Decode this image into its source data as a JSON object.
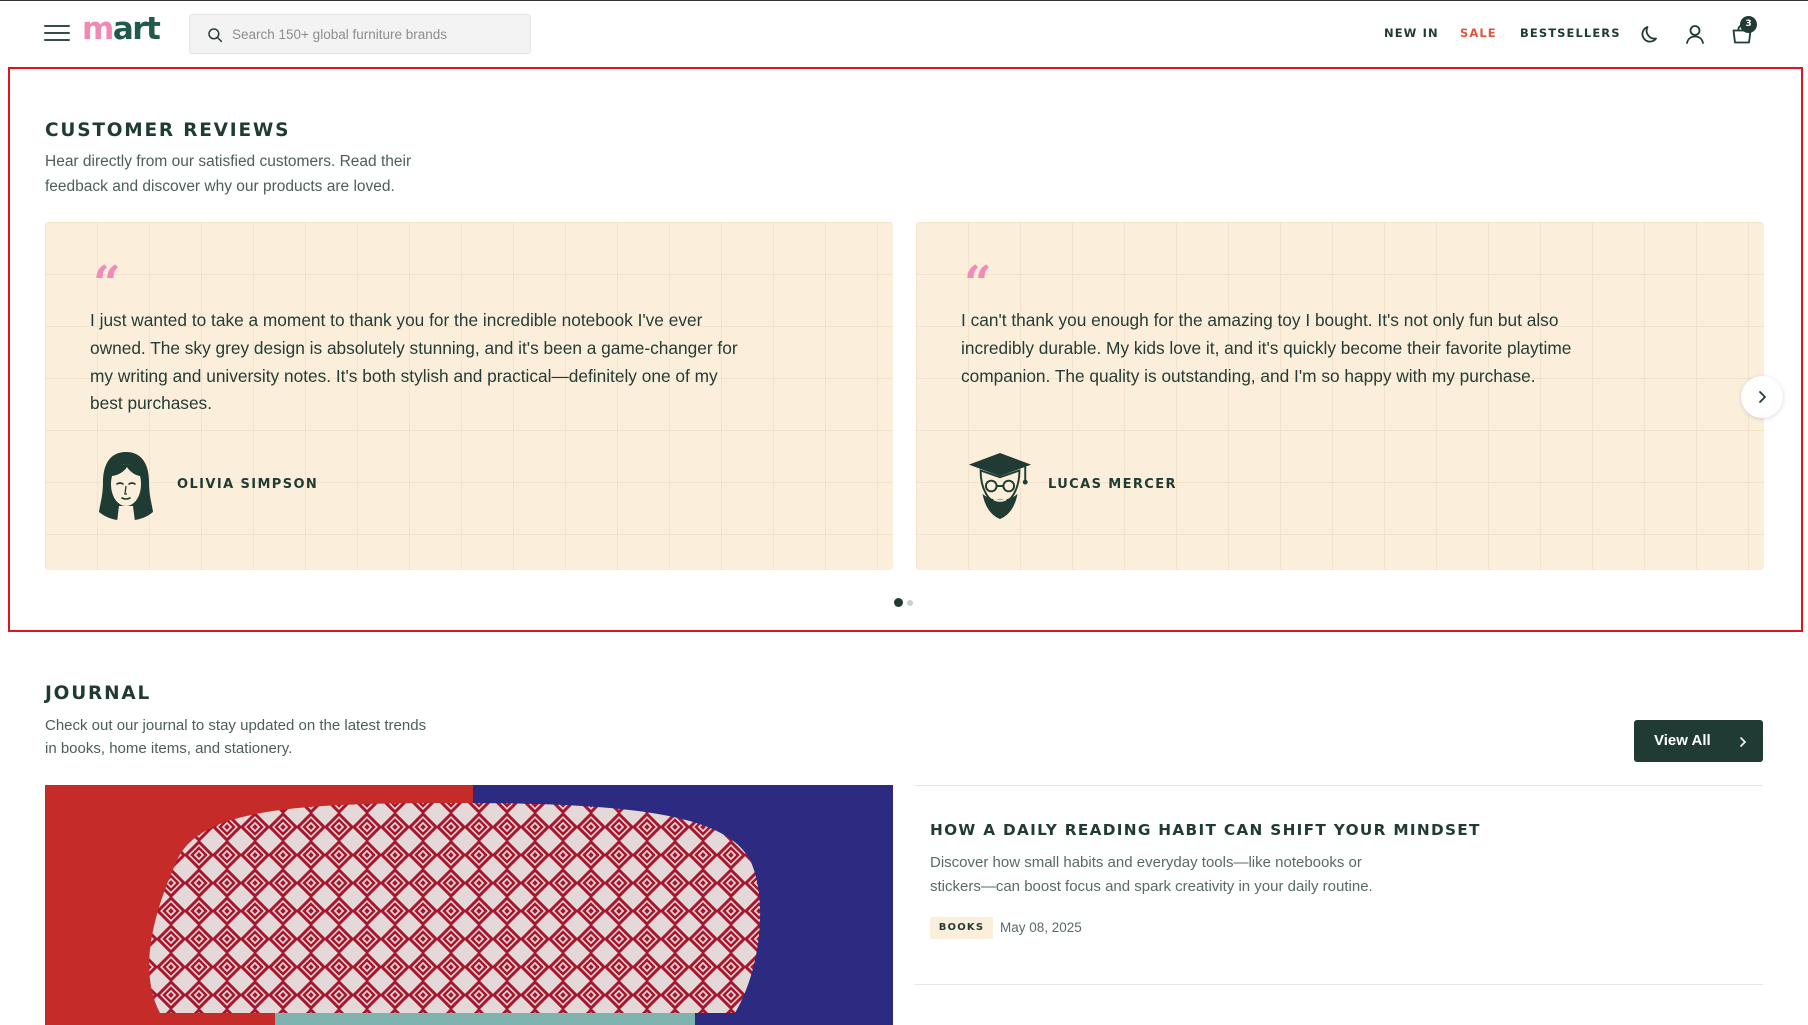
{
  "header": {
    "logo_m": "m",
    "logo_rest": "art",
    "search_placeholder": "Search 150+ global furniture brands",
    "nav": [
      "NEW IN",
      "SALE",
      "BESTSELLERS"
    ],
    "cart_count": "3",
    "icons": [
      "menu-icon",
      "search-icon",
      "moon-icon",
      "user-icon",
      "bag-icon"
    ]
  },
  "reviews": {
    "title": "CUSTOMER REVIEWS",
    "subtitle_line1": "Hear directly from our satisfied customers. Read their",
    "subtitle_line2": "feedback and discover why our products are loved.",
    "quote_symbol": "“",
    "items": [
      {
        "lines": [
          "I just wanted to take a moment to thank you for the incredible notebook I've ever",
          "owned. The sky grey design is absolutely stunning, and it's been a game-changer for",
          "my writing and university notes. It's both stylish and practical—definitely one of my",
          "best purchases."
        ],
        "author": "OLIVIA SIMPSON"
      },
      {
        "lines": [
          "I can't thank you enough for the amazing toy I bought. It's not only fun but also",
          "incredibly durable. My kids love it, and it's quickly become their favorite playtime",
          "companion. The quality is outstanding, and I'm so happy with my purchase."
        ],
        "author": "LUCAS MERCER"
      }
    ],
    "carousel_page": 1,
    "carousel_pages": 2
  },
  "journal": {
    "title": "JOURNAL",
    "subtitle_line1": "Check out our journal to stay updated on the latest trends",
    "subtitle_line2": "in books, home items, and stationery.",
    "view_all": "View All",
    "article": {
      "title": "HOW A DAILY READING HABIT CAN SHIFT YOUR MINDSET",
      "desc_line1": "Discover how small habits and everyday tools—like notebooks or",
      "desc_line2": "stickers—can boost focus and spark creativity in your daily routine.",
      "tag": "BOOKS",
      "date": "May 08, 2025"
    }
  },
  "colors": {
    "brand_dark": "#1f3b33",
    "brand_pink": "#f08ab4",
    "sale_red": "#e0563d",
    "card_bg": "#fbefdc",
    "highlight_border": "#e0141e"
  }
}
